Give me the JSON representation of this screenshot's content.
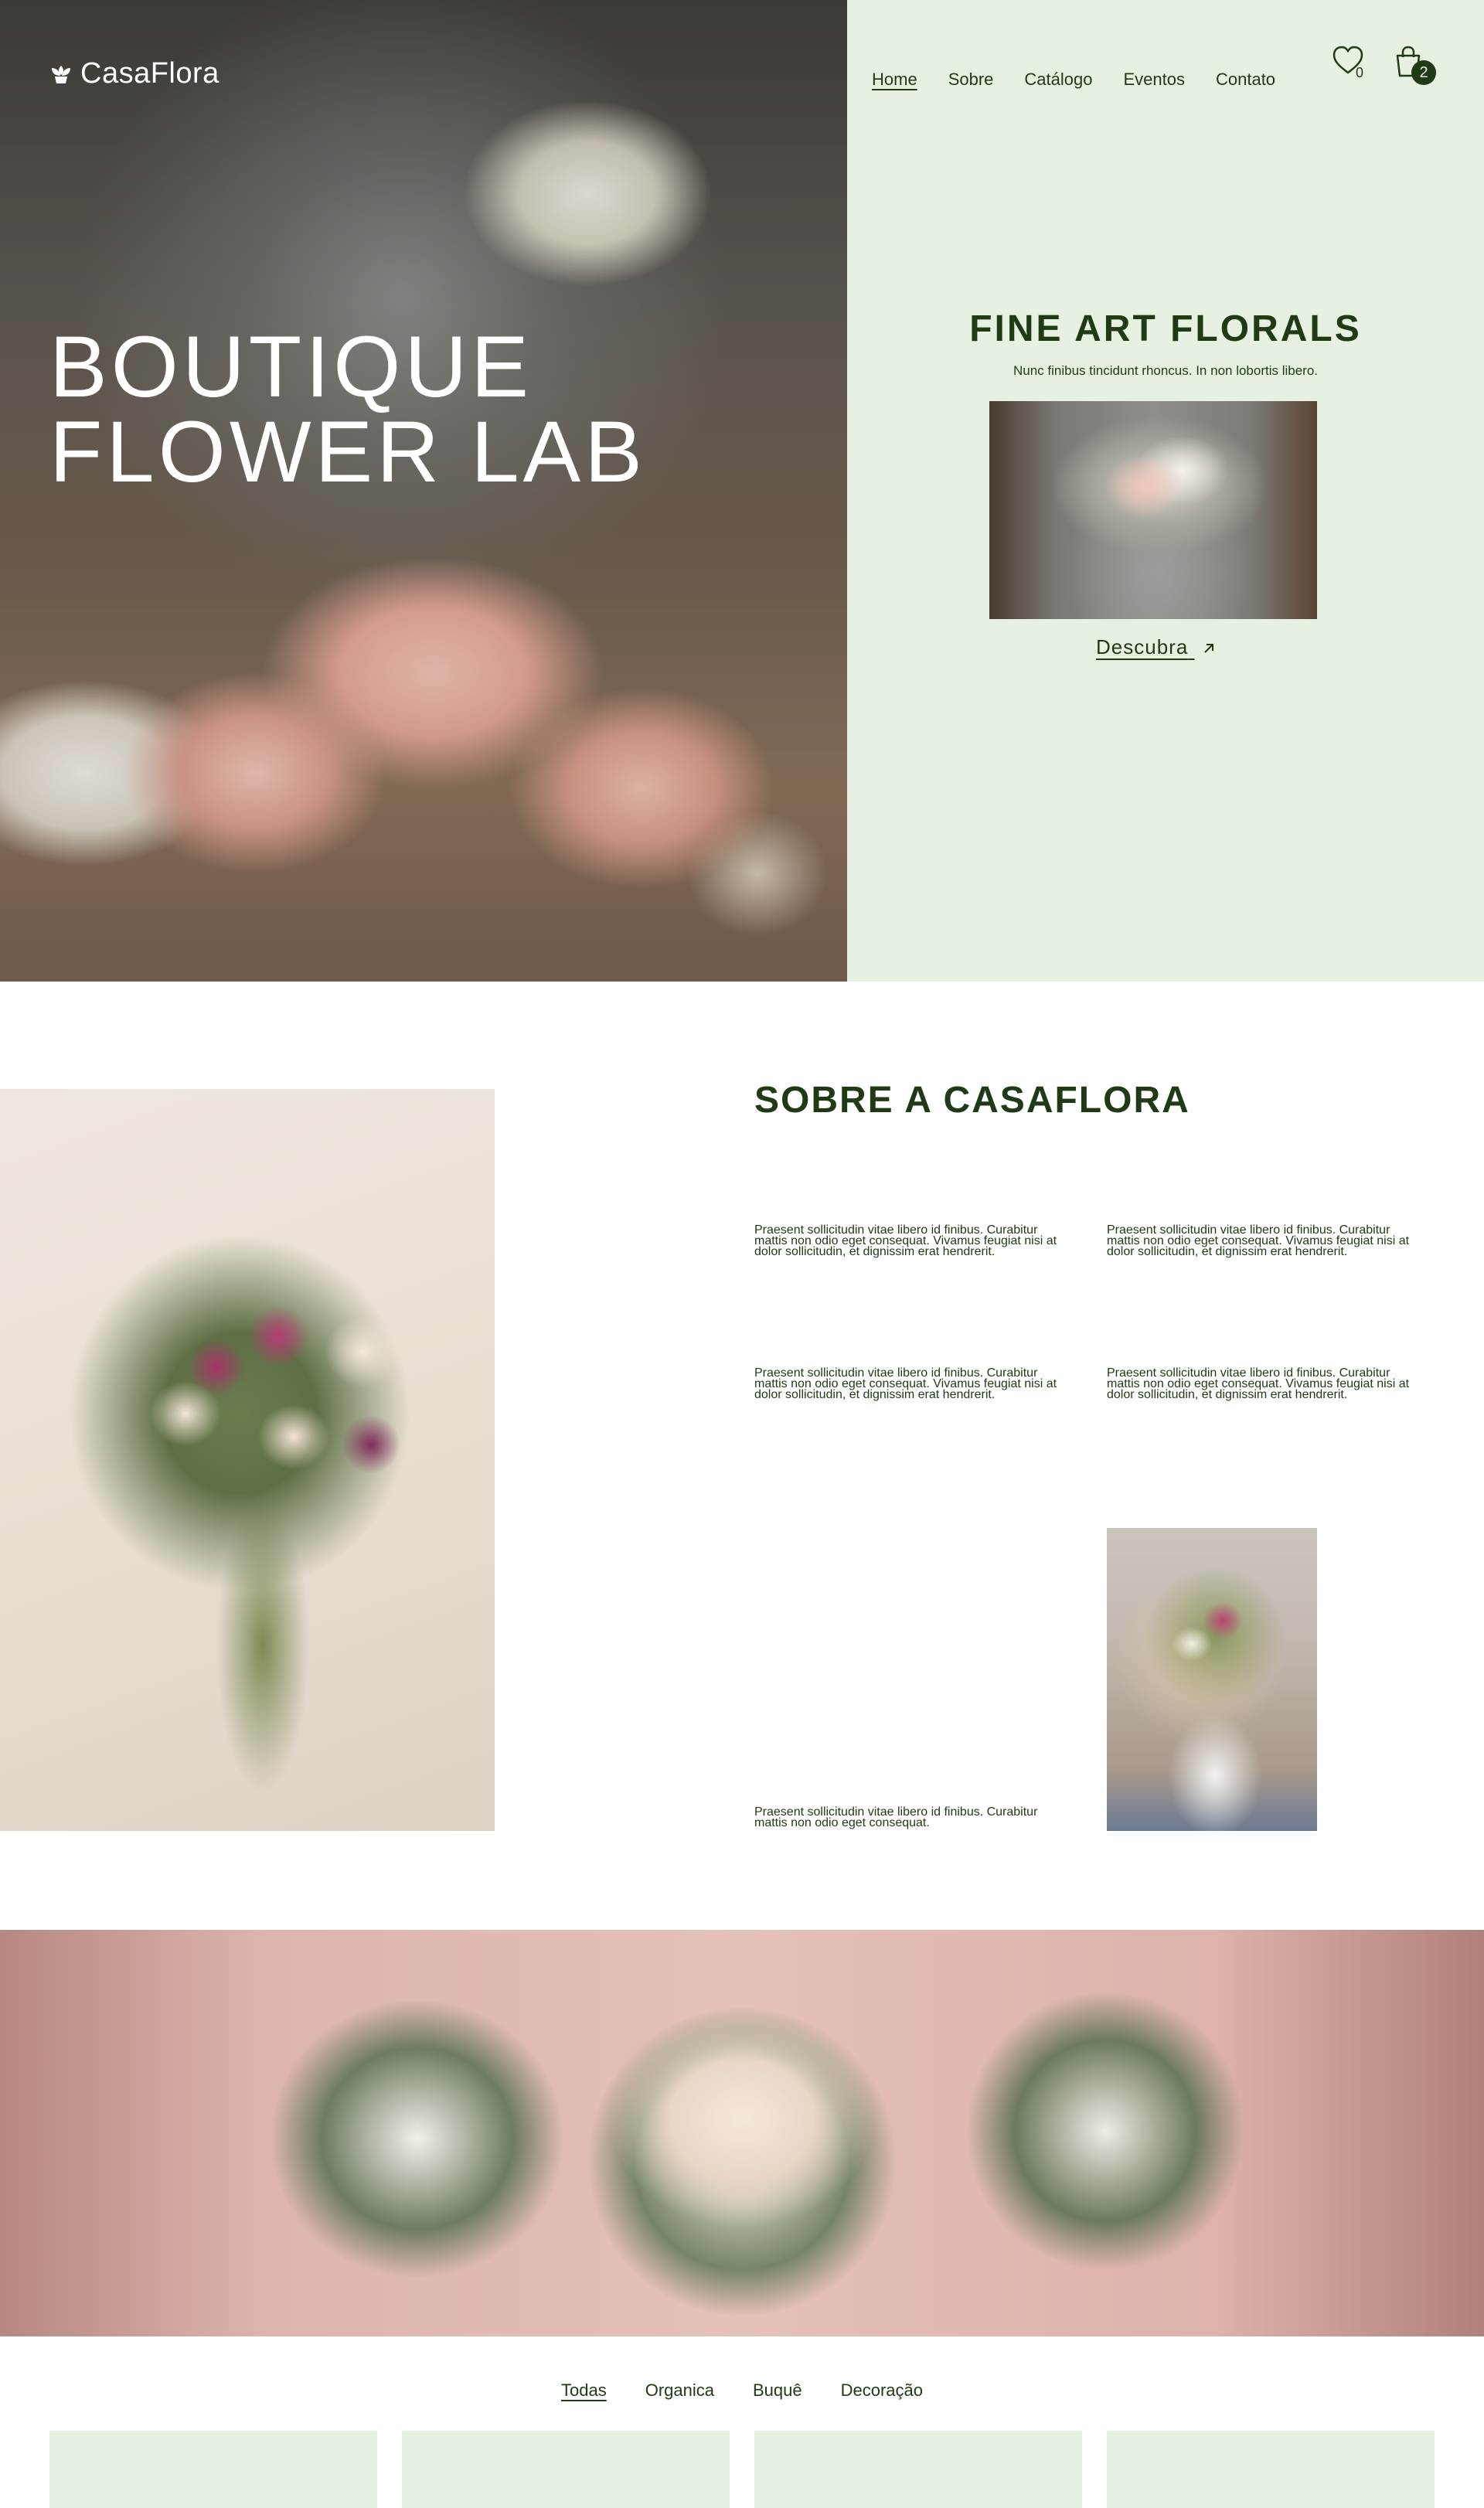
{
  "brand": {
    "name": "CasaFlora"
  },
  "hero": {
    "title_line1": "BOUTIQUE",
    "title_line2": "FLOWER LAB"
  },
  "nav": {
    "items": [
      {
        "label": "Home",
        "active": true
      },
      {
        "label": "Sobre"
      },
      {
        "label": "Catálogo"
      },
      {
        "label": "Eventos"
      },
      {
        "label": "Contato"
      }
    ]
  },
  "wishlist": {
    "icon": "heart-icon",
    "count": "0"
  },
  "cart": {
    "icon": "shopping-bag-icon",
    "count": "2"
  },
  "feature": {
    "title": "FINE ART FLORALS",
    "subtitle": "Nunc finibus tincidunt rhoncus. In non lobortis libero.",
    "cta_label": "Descubra",
    "cta_icon": "arrow-up-right-icon"
  },
  "about": {
    "title": "SOBRE A CASAFLORA",
    "paragraphs": [
      "Praesent sollicitudin vitae libero id finibus. Curabitur mattis non odio eget consequat. Vivamus feugiat nisi at dolor sollicitudin, et dignissim erat hendrerit.",
      "Praesent sollicitudin vitae libero id finibus. Curabitur mattis non odio eget consequat. Vivamus feugiat nisi at dolor sollicitudin, et dignissim erat hendrerit.",
      "Praesent sollicitudin vitae libero id finibus. Curabitur mattis non odio eget consequat. Vivamus feugiat nisi at dolor sollicitudin, et dignissim erat hendrerit.",
      "Praesent sollicitudin vitae libero id finibus. Curabitur mattis non odio eget consequat. Vivamus feugiat nisi at dolor sollicitudin, et dignissim erat hendrerit.",
      "Praesent sollicitudin vitae libero id finibus. Curabitur mattis non odio eget consequat."
    ]
  },
  "filters": {
    "items": [
      {
        "label": "Todas",
        "active": true
      },
      {
        "label": "Organica"
      },
      {
        "label": "Buquê"
      },
      {
        "label": "Decoração"
      }
    ]
  },
  "colors": {
    "accent_dark_green": "#1f3a14",
    "panel_mint": "#e6f1e2",
    "white": "#ffffff"
  }
}
